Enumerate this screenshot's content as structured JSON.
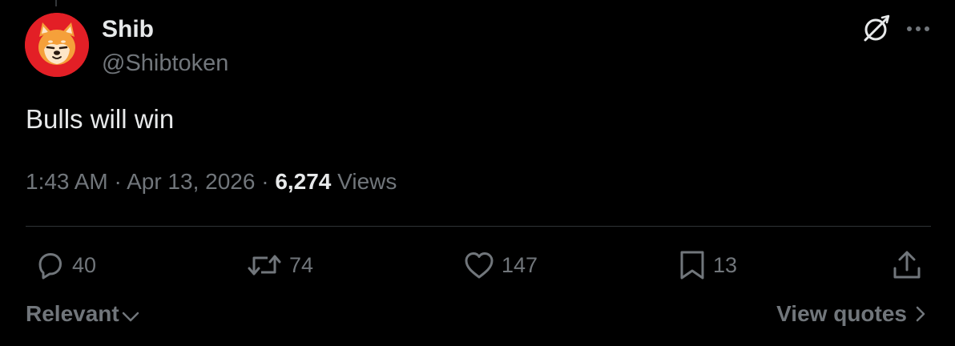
{
  "author": {
    "display_name": "Shib",
    "handle": "@Shibtoken",
    "avatar_icon": "shiba-inu-avatar",
    "avatar_bg": "#e31f26"
  },
  "header_icons": [
    "grok-icon",
    "more-options-icon"
  ],
  "tweet": {
    "text": "Bulls will win",
    "time": "1:43 AM",
    "separator": "·",
    "date": "Apr 13, 2026",
    "views_count": "6,274",
    "views_label": "Views"
  },
  "actions": {
    "replies": "40",
    "reposts": "74",
    "likes": "147",
    "bookmarks": "13"
  },
  "footer": {
    "sort_label": "Relevant",
    "quotes_label": "View quotes"
  },
  "colors": {
    "background": "#000000",
    "primary_text": "#e7e9ea",
    "secondary_text": "#71767b",
    "divider": "#2f3336"
  }
}
